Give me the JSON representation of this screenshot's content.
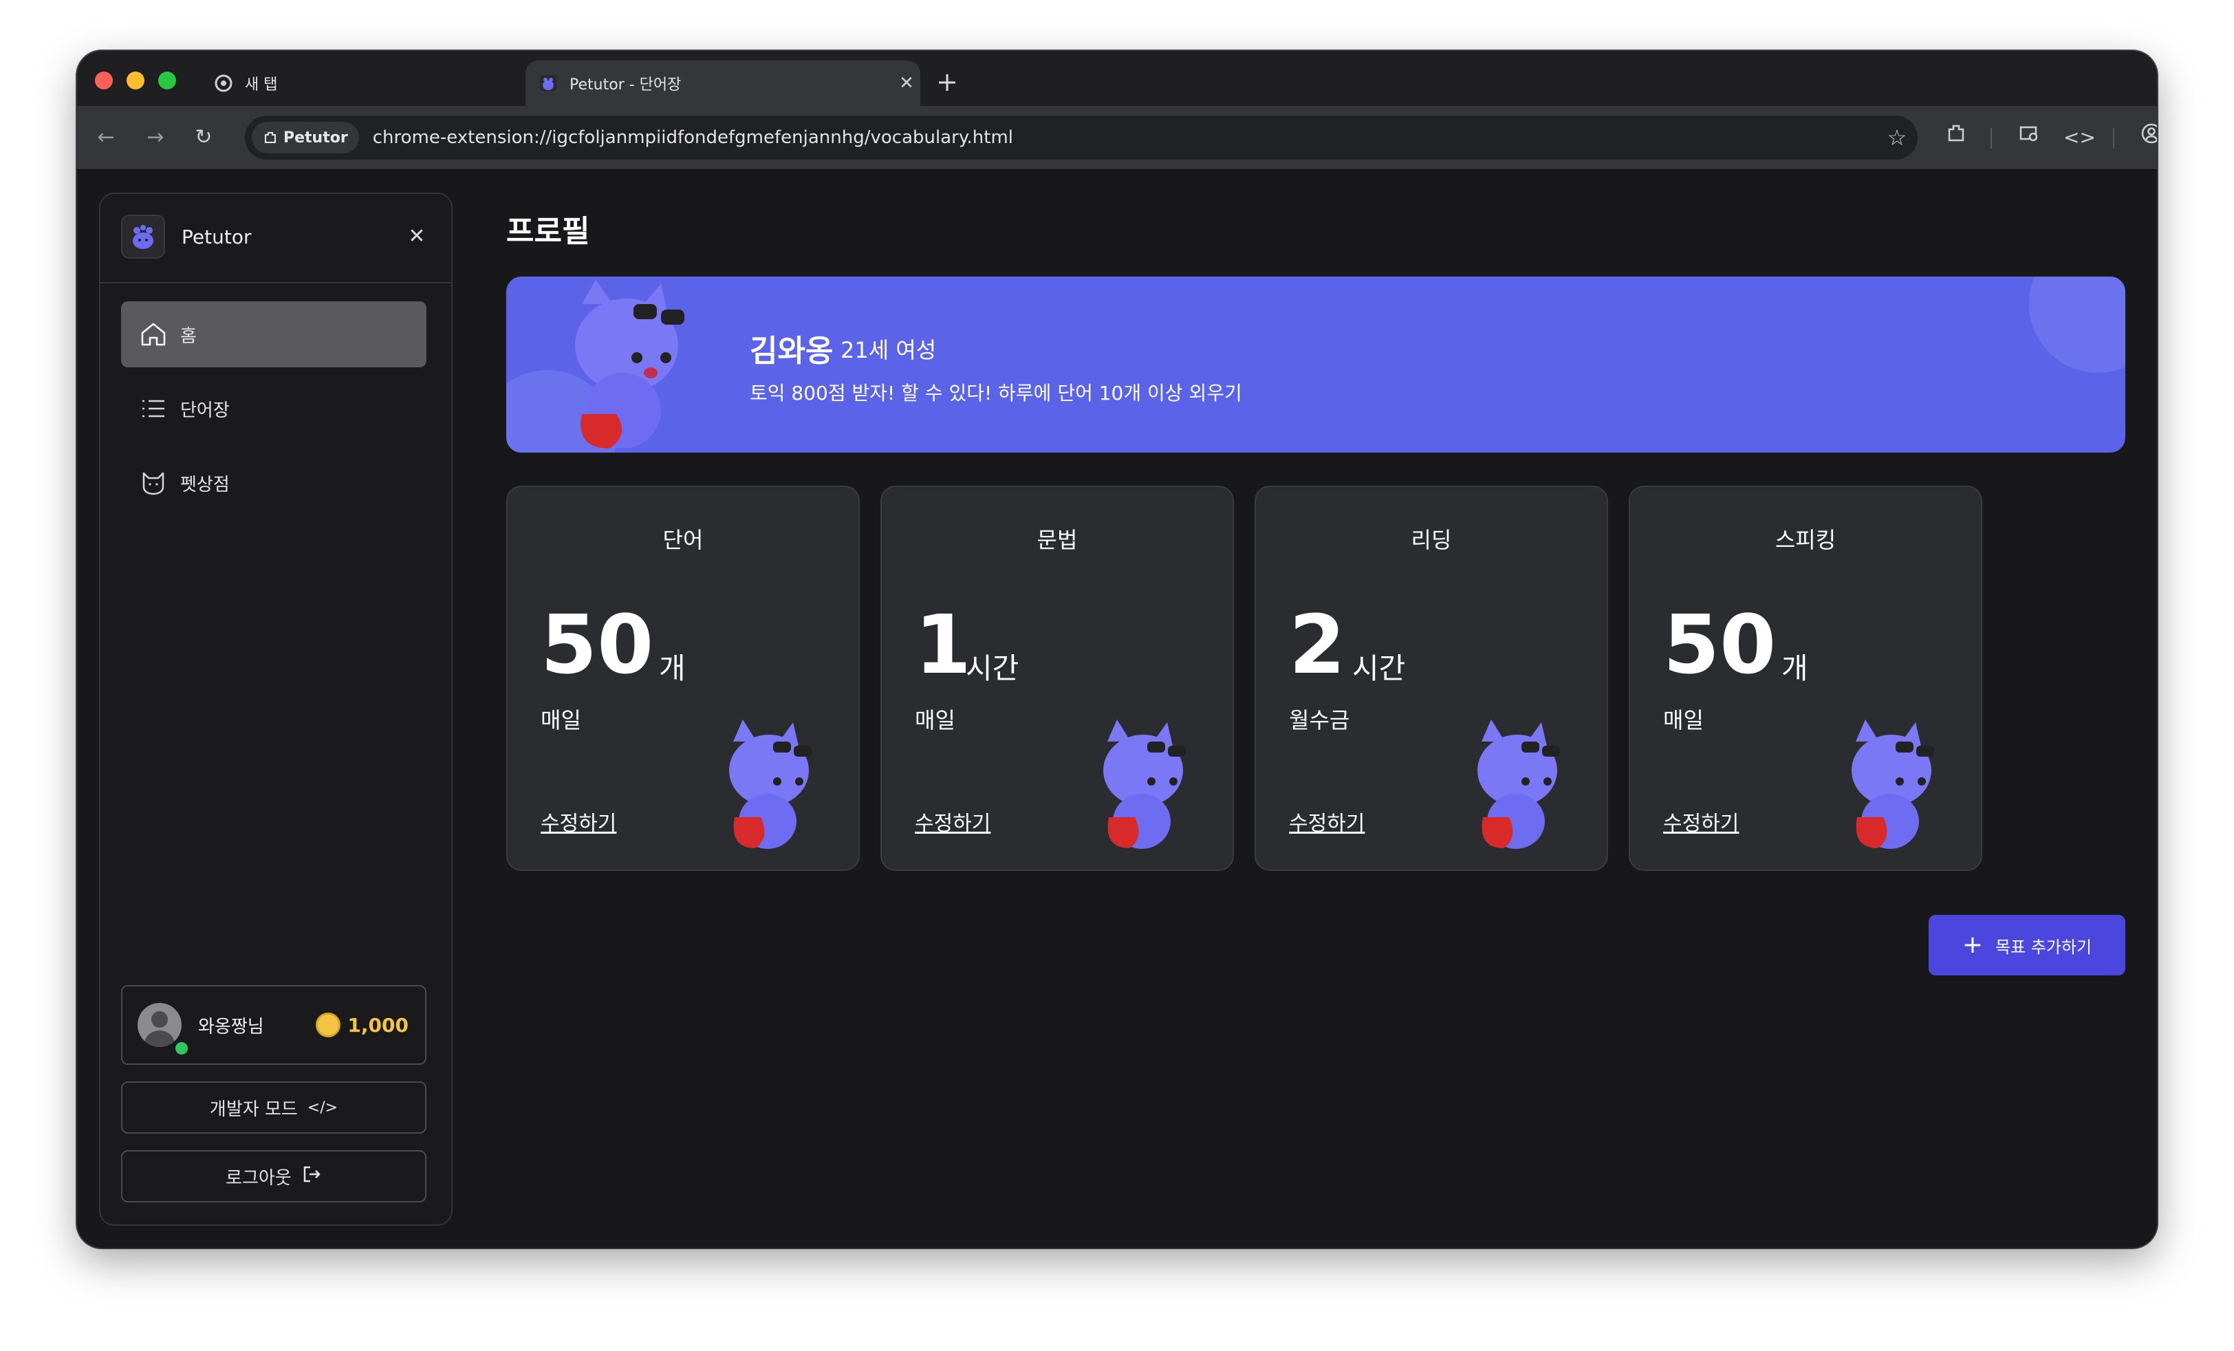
{
  "browser": {
    "tabs": [
      {
        "title": "새 탭",
        "active": false
      },
      {
        "title": "Petutor - 단어장",
        "active": true
      }
    ],
    "site_chip": "Petutor",
    "url": "chrome-extension://igcfoljanmpiidfondefgmefenjannhg/vocabulary.html"
  },
  "sidebar": {
    "app_name": "Petutor",
    "items": [
      {
        "label": "홈",
        "icon": "home-icon",
        "active": true
      },
      {
        "label": "단어장",
        "icon": "list-icon",
        "active": false
      },
      {
        "label": "펫상점",
        "icon": "cat-icon",
        "active": false
      }
    ],
    "user": {
      "name": "와옹짱님",
      "coins": "1,000",
      "online": true
    },
    "dev_mode_label": "개발자 모드",
    "logout_label": "로그아웃"
  },
  "main": {
    "title": "프로필",
    "profile": {
      "name": "김와옹",
      "meta": "21세 여성",
      "goal": "토익 800점 받자! 할 수 있다! 하루에 단어 10개 이상 외우기"
    },
    "cards": [
      {
        "category": "단어",
        "number": "50",
        "unit": "개",
        "frequency": "매일",
        "edit_label": "수정하기"
      },
      {
        "category": "문법",
        "number": "1",
        "unit": "시간",
        "frequency": "매일",
        "edit_label": "수정하기"
      },
      {
        "category": "리딩",
        "number": "2",
        "unit": "시간",
        "frequency": "월수금",
        "edit_label": "수정하기"
      },
      {
        "category": "스피킹",
        "number": "50",
        "unit": "개",
        "frequency": "매일",
        "edit_label": "수정하기"
      }
    ],
    "add_goal_label": "목표 추가하기"
  },
  "colors": {
    "accent": "#5b63e8",
    "button": "#4b46dd",
    "card_bg": "#2b2c30",
    "coin": "#f5c542"
  }
}
